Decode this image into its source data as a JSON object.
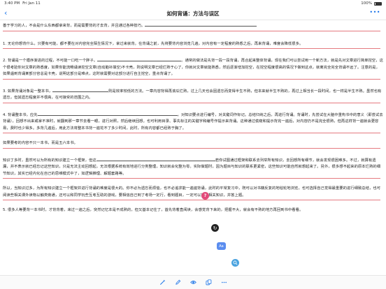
{
  "status": {
    "time": "3:40 PM",
    "date": "Fri Jan 11",
    "battery": "100%"
  },
  "nav": {
    "title": "如何背诵：方法与误区",
    "back_label": "‹",
    "more_label": "•••"
  },
  "paragraphs": [
    {
      "lines": [
        {
          "text": "善于学习的人，不会是什么东西都拿来背，而是需要背的才去背，并且通过各种技巧。",
          "blank_after": true
        }
      ],
      "underline_count": 1
    },
    {
      "lines": [
        {
          "text": "1. 无论你想背什么，只要有可能，都不要在对内容完全陌生情况下，拿过来就背。在背诵之前，先将要背内容浏览几遍，对内容有一定程度的熟悉之后，再来背诵，难度会降低很多。"
        }
      ],
      "underline_count": 1
    },
    {
      "lines": [
        {
          "text": "2. 背诵是一个循序渐进的过程，不可能一口吃一个胖子。",
          "blank_after": true,
          "text_after": "。通常的做法是先背一段一段背诵，再合起来整体背诵，现在我们可以尝试用一个新方法，就是先对文章进行简单挖空，这个很考验你对文章的熟悉度，如果你能流畅诵读挖空文章(自动脑补填空)不卡壳，则说明文章已经烂熟于心了，你就对文章就能熟悉，然后逐渐增加挖空，在挖空程度很高的情况下做到这点，就离完全完全背诵不远了。注意的是，如果遇到背诵某部分容总是卡壳，说明这部分是难点，这时就需要对这部分进行自主挖空，重点背诵了。"
        }
      ],
      "underline_count": 3
    },
    {
      "lines": [
        {
          "text": "3. 如果背诵对象是一整本书，",
          "blank_after": true,
          "text_after": "则是效率较低的方法。一章内容背得再滚瓜烂熟，过上几天也会因遗忘而变得半生不熟，但本来就半生不熟的，再过上相当长一段时间，也一样是半生不熟。虽然也有遗忘，但其遗忘程度并不很高，在可接受的范围之内。"
        }
      ],
      "underline_count": 2
    },
    {
      "lines": [
        {
          "text": "4. 背诵整本书，应先",
          "blank_after": true,
          "text_after": "，对知识要点进行编号，对关键词作标记。总结归纳之后，再进行背诵。背诵时，先尝试在大脑中重构书中的意义（即尝试去背诵），回想不出来或拿不准时，就翻到那一章节去看一眼，进行对照，然后继续回想。也可利用目录、事先标注的关键字和编号作提示来背诵。这种通过偷窥和提示背完一遍后，对内容仍不是完全很熟，但再这样背一遍就会更容易，费时也少得多。多背几遍后，用此方法将整本书背一遍花不了多少时间，此时，所有内容都已经熟于胸了。"
        }
      ],
      "underline_count": 3
    },
    {
      "lines": [
        {
          "text": "如果要考的内容不只一本书，而是五六本书。"
        }
      ],
      "underline_count": 1
    },
    {
      "lines": [
        {
          "text": "知识丁多时，虽然可以为所有的知识建立一个框架，但这",
          "blank_after": true,
          "text_after": "若你试图通过框架和联系去列举所有知识，去回想所有细节，就会发现很困难多。不过，就算有遗漏，并不表示就已经忘记这些知识，只是无法主动回想起，无法根据系统有效地进行分类整理，知识就会化整为零。实际做题时，因为题目与知识的联系更紧密，这些知识可能自然就想起来了。另外，很多想不起来的原本烂熟的细节知识，其实已经内化在自己的思维模式中了，如逻辑推理、解题套路等。"
        }
      ],
      "underline_count": 3
    },
    {
      "lines": [
        {
          "text": "所以，当知识过多，为所有知识建立一个框架并进行背诵的难度是很大的。你不必为遗忘而烦恼，也不必追求能一遍遍背诵，此时的平常复习中，既可以对书籍反复的地毯轮地浏览，也可选择自己觉得最重要的进行细致总结，也可阅读些相关课外读物以触类旁通，还可以和同学玩些互考互助的游戏，要相信自己到了考场一定行，看到题目，一定可以想起相关知识，并答上题。"
        }
      ],
      "underline_count": 2
    },
    {
      "lines": [
        {
          "text": "5. 很多人等要背一本书时，才背背着，来过一遍之后，突然记忆本是不成熟的，但又基本记住了，首先背着直阅读，会感觉背下来的，把握不大，就会有不熟的地方再回到书中看看。"
        }
      ],
      "underline_count": 0
    }
  ],
  "toolbar": {
    "items": [
      "magic-wand-icon",
      "pencil-icon",
      "eye-icon",
      "copy-icon",
      "more-icon"
    ]
  },
  "overlay": {
    "badge_question": "?",
    "badge_redo": "↻",
    "badge_au": "Aa"
  }
}
